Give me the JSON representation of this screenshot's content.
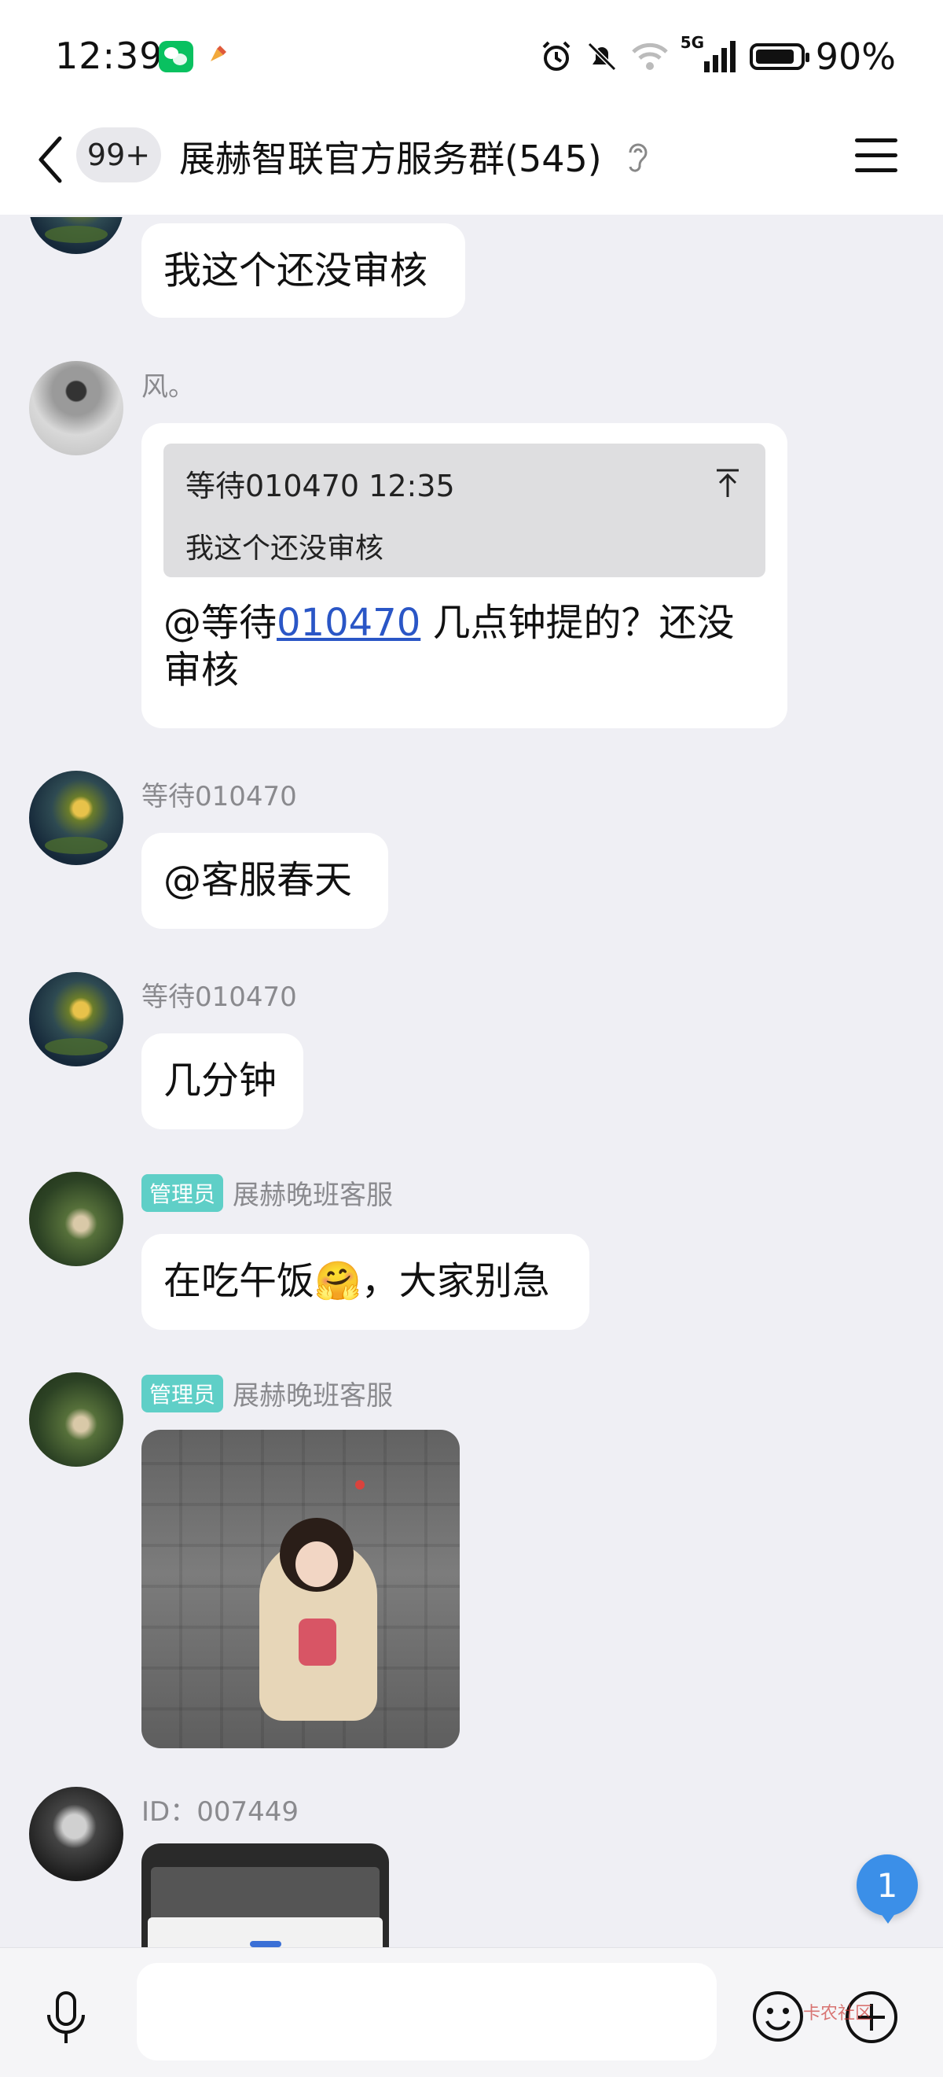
{
  "status_bar": {
    "time": "12:39",
    "network": "5G",
    "battery": "90%"
  },
  "header": {
    "unread": "99+",
    "title": "展赫智联官方服务群(545)"
  },
  "messages": [
    {
      "text": "我这个还没审核"
    },
    {
      "sender": "风。",
      "quote": {
        "name": "等待010470 12:35",
        "text": "我这个还没审核"
      },
      "text_prefix": "@等待",
      "link": "010470",
      "text_suffix": " 几点钟提的？还没",
      "text_line2": "审核"
    },
    {
      "sender": "等待010470",
      "text": "@客服春天"
    },
    {
      "sender": "等待010470",
      "text": "几分钟"
    },
    {
      "badge": "管理员",
      "sender": "展赫晚班客服",
      "text": "在吃午饭🤗，大家别急"
    },
    {
      "badge": "管理员",
      "sender": "展赫晚班客服"
    },
    {
      "sender": "ID：007449"
    }
  ],
  "floating_unread": "1",
  "input": {
    "placeholder": ""
  },
  "watermark": "卡农社区",
  "colors": {
    "background": "#efeff4",
    "bubble": "#ffffff",
    "admin_badge": "#5fcfc7",
    "link": "#2a56c6",
    "unread_badge": "#3b8fe8"
  }
}
